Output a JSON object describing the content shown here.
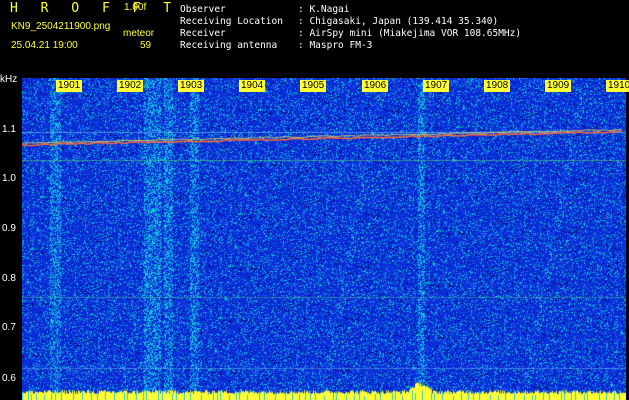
{
  "header": {
    "app_name": "H R O F F T",
    "version": "1.00f",
    "filename": "KN9_2504211900.png",
    "meteor_label": "meteor",
    "datetime": "25.04.21 19:00",
    "meteor_count": "59",
    "info": [
      {
        "label": "Observer",
        "value": "K.Nagai"
      },
      {
        "label": "Receiving Location",
        "value": "Chigasaki, Japan (139.414 35.340)"
      },
      {
        "label": "Receiver",
        "value": "AirSpy mini (Miakejima VOR 108.65MHz)"
      },
      {
        "label": "Receiving antenna",
        "value": "Maspro FM-3"
      }
    ]
  },
  "spectrogram": {
    "y_unit": "kHz",
    "y_ticks": [
      "1.1",
      "1.0",
      "0.9",
      "0.8",
      "0.7",
      "0.6"
    ],
    "x_ticks": [
      "1901",
      "1902",
      "1903",
      "1904",
      "1905",
      "1906",
      "1907",
      "1908",
      "1909",
      "1910"
    ],
    "colors": {
      "background": "#0a2bd6",
      "noise": "#14c8e0",
      "signal": "#ffff33",
      "carrier": "#ff6a3a"
    }
  }
}
